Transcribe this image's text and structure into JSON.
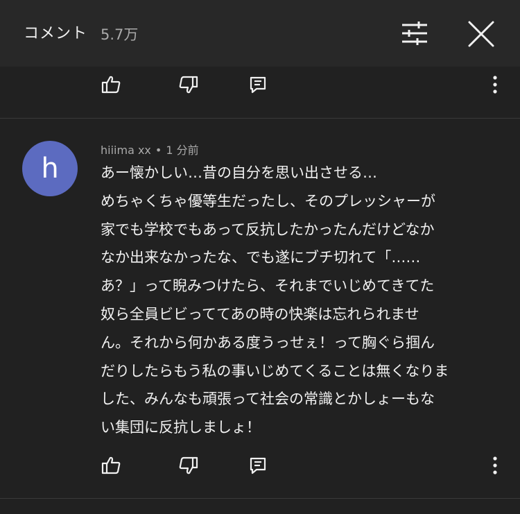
{
  "header": {
    "title": "コメント",
    "count": "5.7万"
  },
  "icons": {
    "filter": "sliders-icon",
    "close": "close-icon",
    "like": "thumb-up-icon",
    "dislike": "thumb-down-icon",
    "reply": "comment-icon",
    "more": "more-vertical-icon"
  },
  "comment": {
    "author": "hiiima xx",
    "time": "1 分前",
    "avatar_letter": "h",
    "avatar_color": "#5c6bc0",
    "lines": [
      "あー懐かしい…昔の自分を思い出させる…",
      "めちゃくちゃ優等生だったし、そのプレッシャーが",
      "家でも学校でもあって反抗したかったんだけどなか",
      "なか出来なかったな、でも遂にブチ切れて「……",
      "あ？」って睨みつけたら、それまでいじめてきてた",
      "奴ら全員ビビっててあの時の快楽は忘れられませ",
      "ん。それから何かある度うっせぇ！って胸ぐら掴ん",
      "だりしたらもう私の事いじめてくることは無くなりま",
      "した、みんなも頑張って社会の常識とかしょーもな",
      "い集団に反抗しましょ！"
    ]
  }
}
